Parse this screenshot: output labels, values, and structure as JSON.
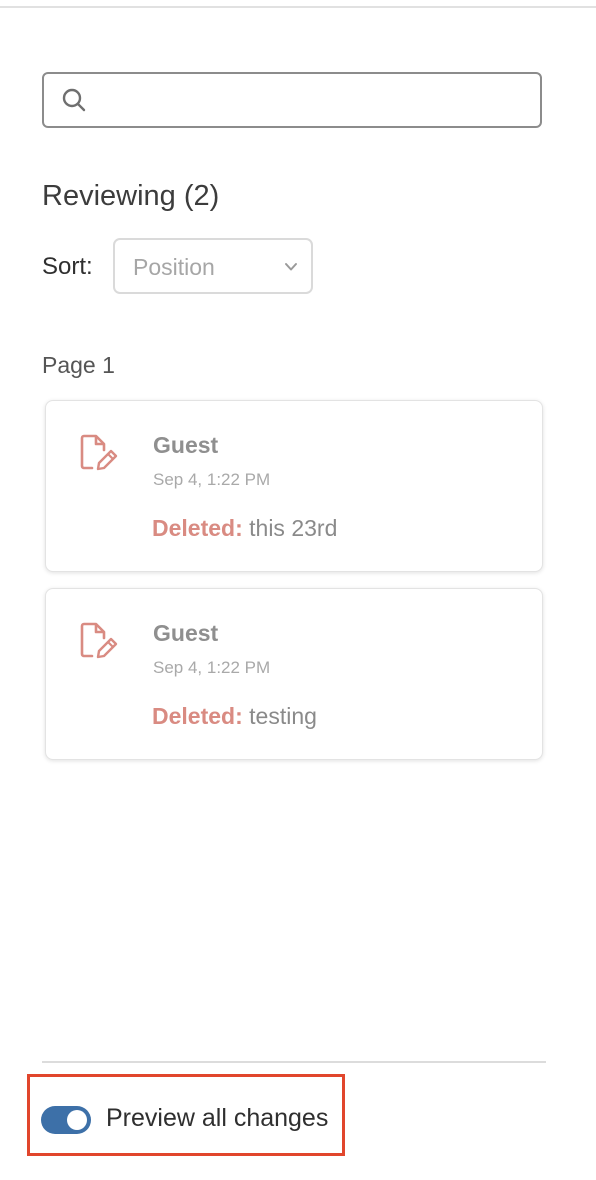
{
  "search": {
    "value": "",
    "placeholder": ""
  },
  "panel": {
    "heading": "Reviewing (2)",
    "sort_label": "Sort:",
    "sort_value": "Position",
    "page_label": "Page 1"
  },
  "changes": [
    {
      "author": "Guest",
      "timestamp": "Sep 4, 1:22 PM",
      "type_label": "Deleted:",
      "text": " this 23rd"
    },
    {
      "author": "Guest",
      "timestamp": "Sep 4, 1:22 PM",
      "type_label": "Deleted:",
      "text": " testing"
    }
  ],
  "footer": {
    "toggle_label": "Preview all changes",
    "toggle_on": true
  },
  "colors": {
    "accent_toggle": "#3d70a8",
    "deleted_label": "#d98b82",
    "edit_icon": "#d98b82",
    "highlight_border": "#e1462c"
  },
  "icons": {
    "search": "search-icon",
    "sort_dropdown": "chevron-down-icon",
    "change": "document-edit-icon"
  }
}
